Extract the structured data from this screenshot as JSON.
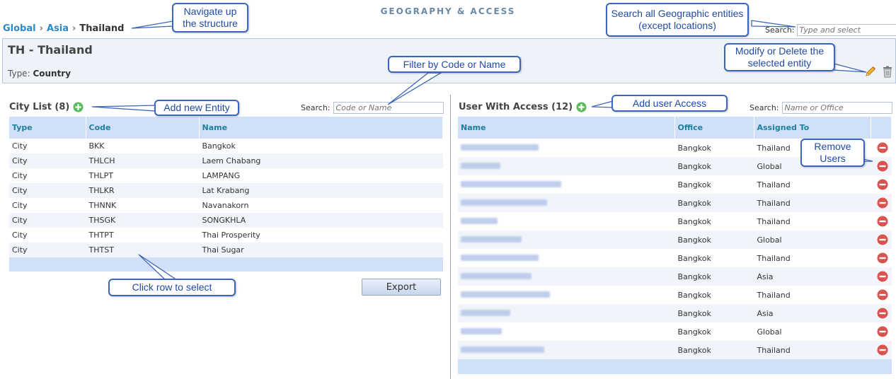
{
  "app_title": "GEOGRAPHY & ACCESS",
  "breadcrumb": {
    "items": [
      "Global",
      "Asia"
    ],
    "current": "Thailand",
    "separator": "›"
  },
  "global_search": {
    "label": "Search:",
    "placeholder": "Type and select"
  },
  "entity": {
    "title": "TH - Thailand",
    "type_label": "Type:",
    "type_value": "Country"
  },
  "city_list": {
    "title": "City List (8)",
    "search_label": "Search:",
    "search_placeholder": "Code or Name",
    "columns": [
      "Type",
      "Code",
      "Name"
    ],
    "rows": [
      [
        "City",
        "BKK",
        "Bangkok"
      ],
      [
        "City",
        "THLCH",
        "Laem Chabang"
      ],
      [
        "City",
        "THLPT",
        "LAMPANG"
      ],
      [
        "City",
        "THLKR",
        "Lat Krabang"
      ],
      [
        "City",
        "THNNK",
        "Navanakorn"
      ],
      [
        "City",
        "THSGK",
        "SONGKHLA"
      ],
      [
        "City",
        "THTPT",
        "Thai Prosperity"
      ],
      [
        "City",
        "THTST",
        "Thai Sugar"
      ]
    ],
    "export_label": "Export"
  },
  "users": {
    "title": "User With Access (12)",
    "search_label": "Search:",
    "search_placeholder": "Name or Office",
    "columns": [
      "Name",
      "Office",
      "Assigned To"
    ],
    "rows": [
      {
        "office": "Bangkok",
        "assigned": "Thailand",
        "linked": false
      },
      {
        "office": "Bangkok",
        "assigned": "Global",
        "linked": true
      },
      {
        "office": "Bangkok",
        "assigned": "Thailand",
        "linked": false
      },
      {
        "office": "Bangkok",
        "assigned": "Thailand",
        "linked": false
      },
      {
        "office": "Bangkok",
        "assigned": "Thailand",
        "linked": false
      },
      {
        "office": "Bangkok",
        "assigned": "Global",
        "linked": true
      },
      {
        "office": "Bangkok",
        "assigned": "Thailand",
        "linked": false
      },
      {
        "office": "Bangkok",
        "assigned": "Asia",
        "linked": true
      },
      {
        "office": "Bangkok",
        "assigned": "Thailand",
        "linked": false
      },
      {
        "office": "Bangkok",
        "assigned": "Asia",
        "linked": true
      },
      {
        "office": "Bangkok",
        "assigned": "Global",
        "linked": true
      },
      {
        "office": "Bangkok",
        "assigned": "Thailand",
        "linked": false
      }
    ]
  },
  "callouts": {
    "navigate": "Navigate up the structure",
    "search_all": "Search all Geographic entities (except locations)",
    "modify": "Modify or Delete the selected entity",
    "filter": "Filter by Code or Name",
    "add_entity": "Add new Entity",
    "add_user": "Add user Access",
    "remove_users": "Remove Users",
    "click_row": "Click row to select"
  },
  "colors": {
    "link": "#2a8ac8",
    "header_bg": "#cfe0f8",
    "callout_border": "#3b66b8",
    "remove": "#d9534f",
    "add": "#5cb85c"
  },
  "icons": {
    "edit": "pencil-icon",
    "delete": "trash-icon",
    "add": "plus-circle-icon",
    "remove": "minus-circle-icon"
  }
}
